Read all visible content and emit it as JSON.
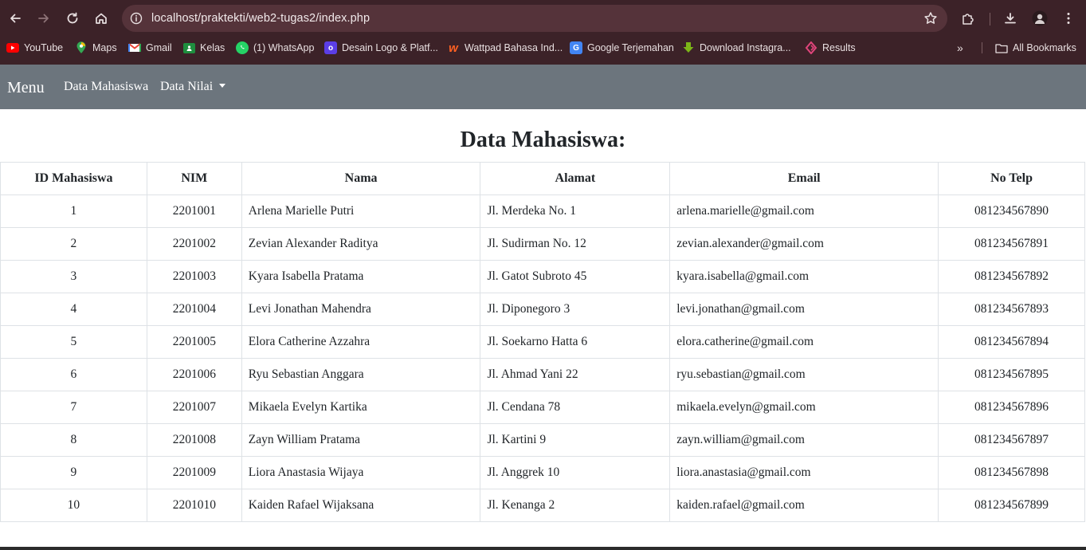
{
  "browser": {
    "url": "localhost/praktekti/web2-tugas2/index.php",
    "bookmarks": [
      {
        "label": "YouTube",
        "icon": "youtube-icon",
        "color": "#ff0000"
      },
      {
        "label": "Maps",
        "icon": "maps-icon",
        "color": "#34a853"
      },
      {
        "label": "Gmail",
        "icon": "gmail-icon",
        "color": "#ea4335"
      },
      {
        "label": "Kelas",
        "icon": "classroom-icon",
        "color": "#1e8e3e"
      },
      {
        "label": "(1) WhatsApp",
        "icon": "whatsapp-icon",
        "color": "#25d366"
      },
      {
        "label": "Desain Logo & Platf...",
        "icon": "canva-icon",
        "color": "#5b3ee6"
      },
      {
        "label": "Wattpad Bahasa Ind...",
        "icon": "wattpad-icon",
        "color": "#ff6122"
      },
      {
        "label": "Google Terjemahan",
        "icon": "translate-icon",
        "color": "#4285f4"
      },
      {
        "label": "Download Instagra...",
        "icon": "download-arrow-icon",
        "color": "#7cb518"
      },
      {
        "label": "Results",
        "icon": "results-icon",
        "color": "#e0457b"
      }
    ],
    "all_bookmarks_label": "All Bookmarks"
  },
  "navbar": {
    "brand": "Menu",
    "links": [
      "Data Mahasiswa",
      "Data Nilai"
    ],
    "bg_color": "#6c757d"
  },
  "main": {
    "title": "Data Mahasiswa:",
    "columns": [
      "ID Mahasiswa",
      "NIM",
      "Nama",
      "Alamat",
      "Email",
      "No Telp"
    ],
    "rows": [
      [
        "1",
        "2201001",
        "Arlena Marielle Putri",
        "Jl. Merdeka No. 1",
        "arlena.marielle@gmail.com",
        "081234567890"
      ],
      [
        "2",
        "2201002",
        "Zevian Alexander Raditya",
        "Jl. Sudirman No. 12",
        "zevian.alexander@gmail.com",
        "081234567891"
      ],
      [
        "3",
        "2201003",
        "Kyara Isabella Pratama",
        "Jl. Gatot Subroto 45",
        "kyara.isabella@gmail.com",
        "081234567892"
      ],
      [
        "4",
        "2201004",
        "Levi Jonathan Mahendra",
        "Jl. Diponegoro 3",
        "levi.jonathan@gmail.com",
        "081234567893"
      ],
      [
        "5",
        "2201005",
        "Elora Catherine Azzahra",
        "Jl. Soekarno Hatta 6",
        "elora.catherine@gmail.com",
        "081234567894"
      ],
      [
        "6",
        "2201006",
        "Ryu Sebastian Anggara",
        "Jl. Ahmad Yani 22",
        "ryu.sebastian@gmail.com",
        "081234567895"
      ],
      [
        "7",
        "2201007",
        "Mikaela Evelyn Kartika",
        "Jl. Cendana 78",
        "mikaela.evelyn@gmail.com",
        "081234567896"
      ],
      [
        "8",
        "2201008",
        "Zayn William Pratama",
        "Jl. Kartini 9",
        "zayn.william@gmail.com",
        "081234567897"
      ],
      [
        "9",
        "2201009",
        "Liora Anastasia Wijaya",
        "Jl. Anggrek 10",
        "liora.anastasia@gmail.com",
        "081234567898"
      ],
      [
        "10",
        "2201010",
        "Kaiden Rafael Wijaksana",
        "Jl. Kenanga 2",
        "kaiden.rafael@gmail.com",
        "081234567899"
      ]
    ]
  }
}
